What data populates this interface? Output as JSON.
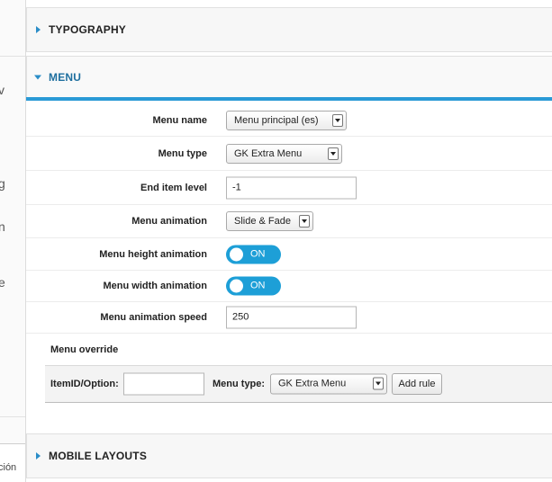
{
  "left_strip": {
    "fragments": [
      "v",
      "g",
      "n",
      "e"
    ],
    "bottom_text": "ción"
  },
  "panels": {
    "typography": "TYPOGRAPHY",
    "menu": "MENU",
    "mobile": "MOBILE LAYOUTS"
  },
  "fields": {
    "menu_name": {
      "label": "Menu name",
      "value": "Menu principal (es)"
    },
    "menu_type": {
      "label": "Menu type",
      "value": "GK Extra Menu"
    },
    "end_item_level": {
      "label": "End item level",
      "value": "-1"
    },
    "menu_animation": {
      "label": "Menu animation",
      "value": "Slide & Fade"
    },
    "menu_height_animation": {
      "label": "Menu height animation",
      "value": "ON"
    },
    "menu_width_animation": {
      "label": "Menu width animation",
      "value": "ON"
    },
    "menu_animation_speed": {
      "label": "Menu animation speed",
      "value": "250"
    }
  },
  "override": {
    "title": "Menu override",
    "itemid_label": "ItemID/Option:",
    "itemid_value": "",
    "menu_type_label": "Menu type:",
    "menu_type_value": "GK Extra Menu",
    "add_rule": "Add rule"
  },
  "colors": {
    "accent": "#2a9ad6",
    "toggle": "#1d9fd7"
  }
}
